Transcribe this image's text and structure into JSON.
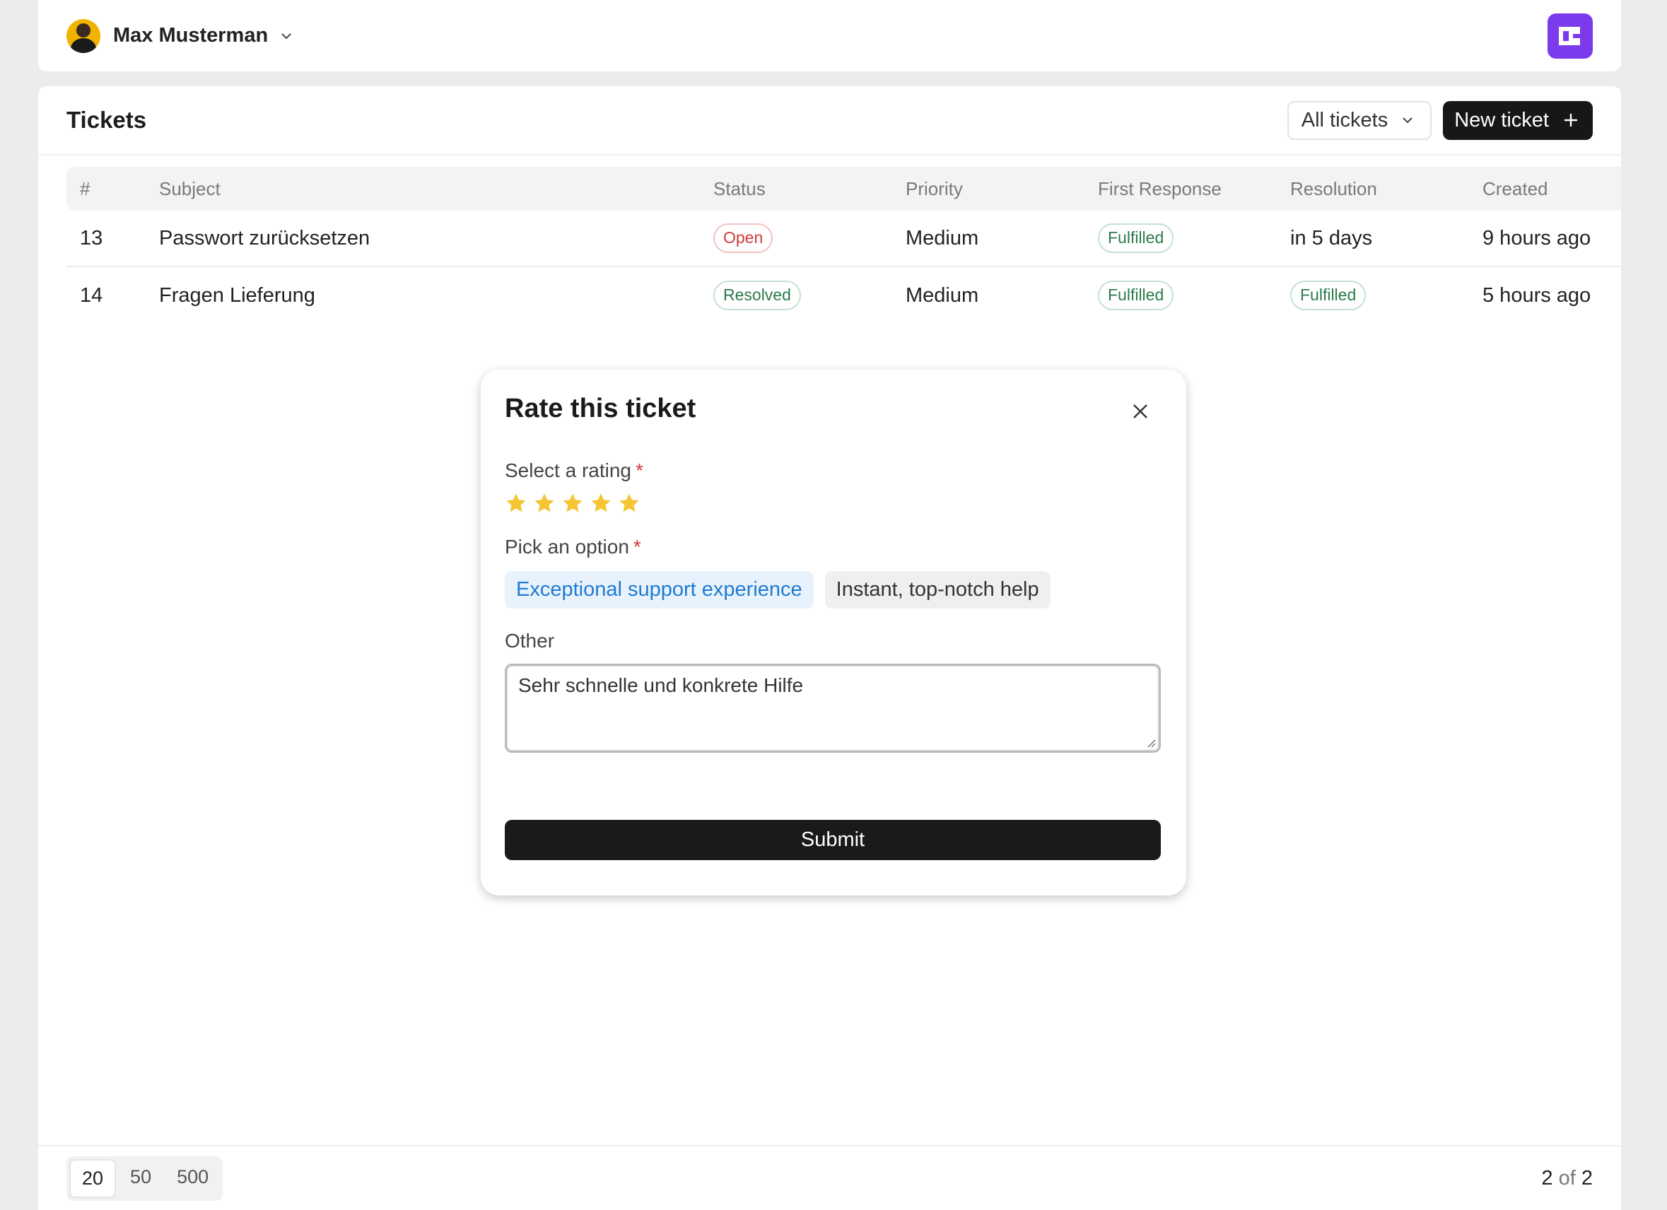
{
  "topbar": {
    "user_name": "Max Musterman"
  },
  "header": {
    "title": "Tickets",
    "filter_label": "All tickets",
    "new_ticket_label": "New ticket"
  },
  "table": {
    "columns": [
      "#",
      "Subject",
      "Status",
      "Priority",
      "First Response",
      "Resolution",
      "Created"
    ],
    "rows": [
      {
        "id": "13",
        "subject": "Passwort zurücksetzen",
        "status": "Open",
        "priority": "Medium",
        "first_response": "Fulfilled",
        "resolution": "in 5 days",
        "created": "9 hours ago"
      },
      {
        "id": "14",
        "subject": "Fragen Lieferung",
        "status": "Resolved",
        "priority": "Medium",
        "first_response": "Fulfilled",
        "resolution": "Fulfilled",
        "created": "5 hours ago"
      }
    ]
  },
  "pagination": {
    "sizes": [
      "20",
      "50",
      "500"
    ],
    "selected": "20",
    "current": "2",
    "of_text": "of",
    "total": "2"
  },
  "modal": {
    "title": "Rate this ticket",
    "rating_label": "Select a rating",
    "required_mark": "*",
    "rating_value": 5,
    "rating_max": 5,
    "option_label": "Pick an option",
    "options": [
      "Exceptional support experience",
      "Instant, top-notch help"
    ],
    "selected_option": "Exceptional support experience",
    "other_label": "Other",
    "other_value": "Sehr schnelle und konkrete Hilfe",
    "submit_label": "Submit"
  },
  "colors": {
    "accent": "#7c3aed",
    "star": "#f5c533",
    "chip_selected_text": "#1f7bd1",
    "status_open": "#d03b3b",
    "status_resolved": "#2c7a4b"
  }
}
